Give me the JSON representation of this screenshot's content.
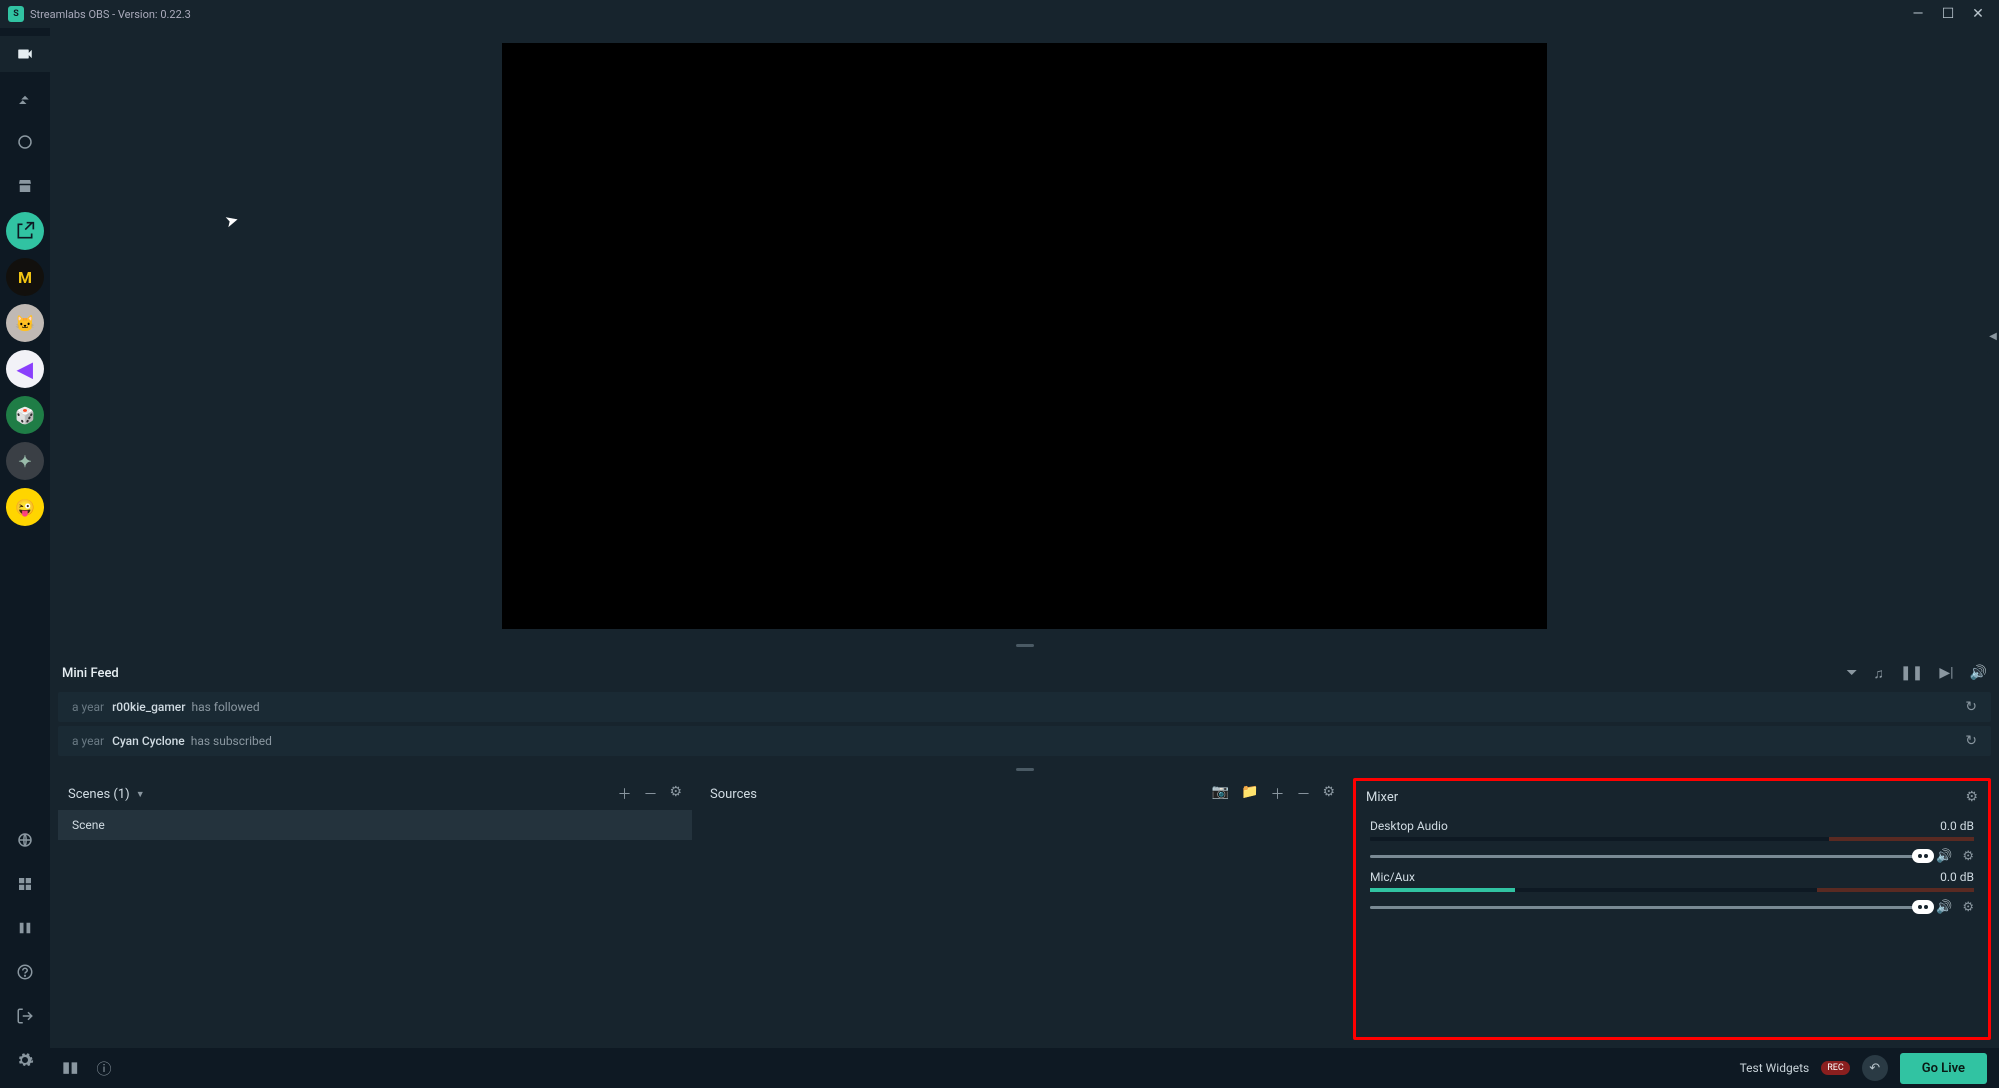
{
  "window": {
    "title": "Streamlabs OBS - Version: 0.22.3"
  },
  "minifeed": {
    "title": "Mini Feed",
    "items": [
      {
        "time": "a year",
        "user": "r00kie_gamer",
        "action": "has followed"
      },
      {
        "time": "a year",
        "user": "Cyan Cyclone",
        "action": "has subscribed"
      }
    ]
  },
  "scenes": {
    "title": "Scenes (1)",
    "items": [
      "Scene"
    ]
  },
  "sources": {
    "title": "Sources"
  },
  "mixer": {
    "title": "Mixer",
    "channels": [
      {
        "name": "Desktop Audio",
        "db": "0.0 dB",
        "greenPct": 0,
        "redPct": 24
      },
      {
        "name": "Mic/Aux",
        "db": "0.0 dB",
        "greenPct": 24,
        "redPct": 26
      }
    ]
  },
  "bottombar": {
    "testWidgets": "Test Widgets",
    "rec": "REC",
    "goLive": "Go Live"
  }
}
